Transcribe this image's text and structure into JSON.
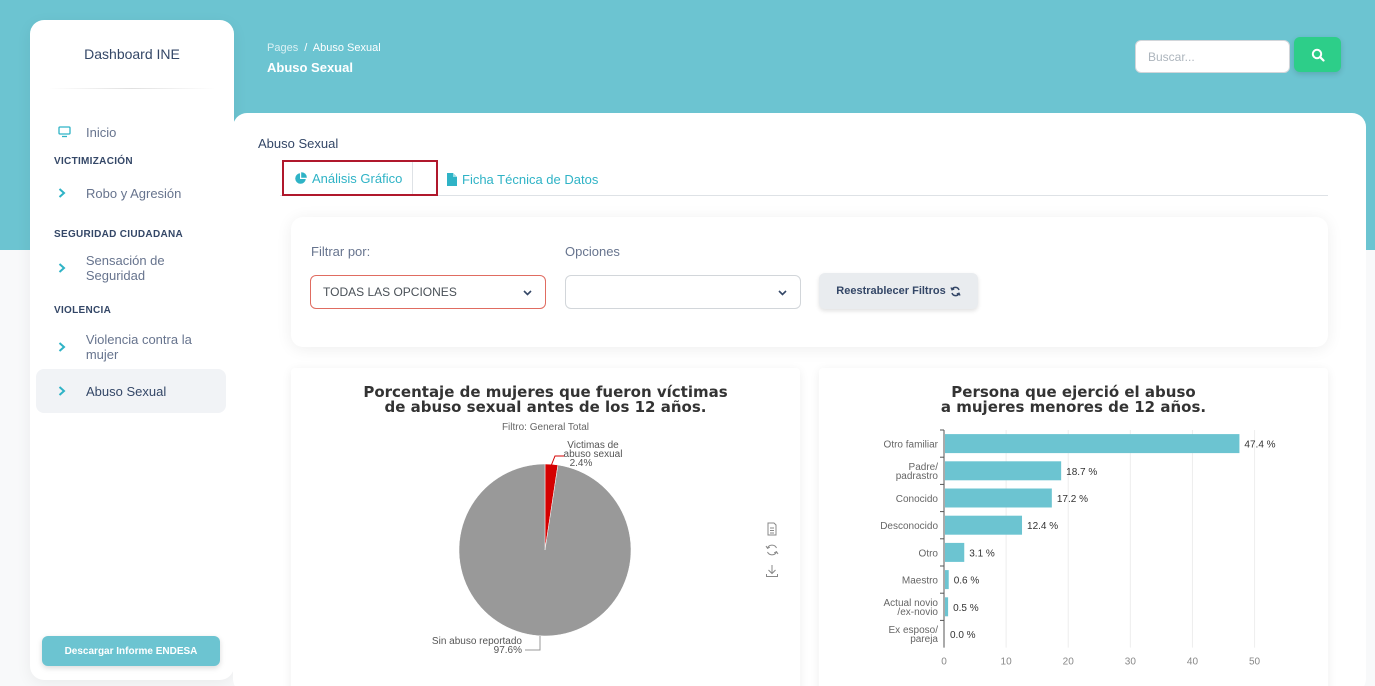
{
  "sidebar": {
    "brand": "Dashboard INE",
    "home": "Inicio",
    "sections": [
      {
        "title": "VICTIMIZACIÓN",
        "items": [
          "Robo y Agresión"
        ]
      },
      {
        "title": "SEGURIDAD CIUDADANA",
        "items": [
          "Sensación de Seguridad"
        ]
      },
      {
        "title": "VIOLENCIA",
        "items": [
          "Violencia contra la mujer",
          "Abuso Sexual"
        ]
      }
    ],
    "download_button": "Descargar Informe ENDESA"
  },
  "header": {
    "breadcrumb_root": "Pages",
    "breadcrumb_sep": "/",
    "breadcrumb_current": "Abuso Sexual",
    "title": "Abuso Sexual",
    "search_placeholder": "Buscar..."
  },
  "main": {
    "card_title": "Abuso Sexual",
    "tabs": [
      "Análisis Gráfico",
      "Ficha Técnica de Datos"
    ],
    "filters": {
      "filter_label": "Filtrar por:",
      "options_label": "Opciones",
      "filter_value": "TODAS LAS OPCIONES",
      "options_value": "",
      "reset_button": "Reestrablecer Filtros"
    }
  },
  "colors": {
    "accent": "#6cc4d1",
    "search_button": "#2dce89",
    "pie_victims": "#d40000",
    "pie_rest": "#999999",
    "bar": "#6cc4d1",
    "tab_highlight": "#b0182c"
  },
  "chart_data": [
    {
      "type": "pie",
      "title_lines": [
        "Porcentaje de mujeres que fueron víctimas",
        "de abuso sexual antes de los 12 años."
      ],
      "subtitle": "Filtro: General Total",
      "slices": [
        {
          "label_lines": [
            "Victimas de",
            "abuso sexual"
          ],
          "value": 2.4,
          "value_label": "2.4%"
        },
        {
          "label_lines": [
            "Sin abuso reportado"
          ],
          "value": 97.6,
          "value_label": "97.6%"
        }
      ],
      "toolbar_icons": [
        "data-view-icon",
        "refresh-icon",
        "download-icon"
      ]
    },
    {
      "type": "bar",
      "orientation": "horizontal",
      "title_lines": [
        "Persona que ejerció el abuso",
        "a mujeres menores de 12 años."
      ],
      "categories": [
        [
          "Otro familiar"
        ],
        [
          "Padre/",
          "padrastro"
        ],
        [
          "Conocido"
        ],
        [
          "Desconocido"
        ],
        [
          "Otro"
        ],
        [
          "Maestro"
        ],
        [
          "Actual novio",
          "/ex-novio"
        ],
        [
          "Ex esposo/",
          "pareja"
        ]
      ],
      "values": [
        47.4,
        18.7,
        17.2,
        12.4,
        3.1,
        0.6,
        0.5,
        0.0
      ],
      "value_labels": [
        "47.4 %",
        "18.7 %",
        "17.2 %",
        "12.4 %",
        "3.1 %",
        "0.6 %",
        "0.5 %",
        "0.0 %"
      ],
      "xlim": [
        0,
        52
      ],
      "xticks": [
        0,
        10,
        20,
        30,
        40,
        50
      ]
    }
  ]
}
